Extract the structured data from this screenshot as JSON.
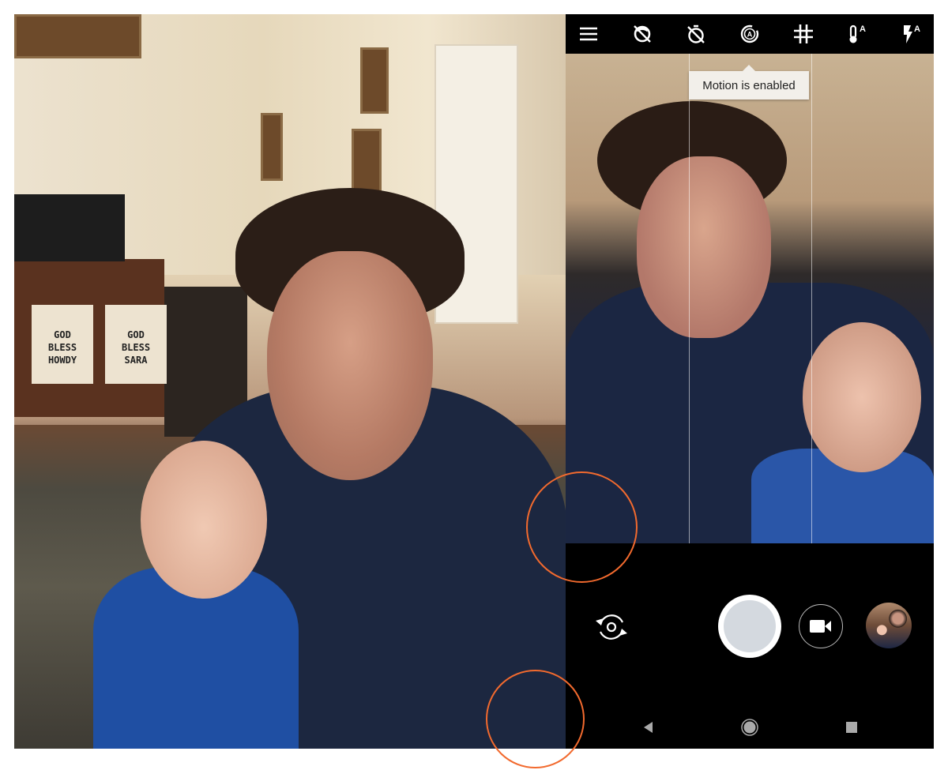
{
  "photo": {
    "banners": [
      "GOD\nBLESS\nHOWDY",
      "GOD\nBLESS\nSARA"
    ]
  },
  "camera": {
    "top_bar": {
      "icons": [
        "menu-icon",
        "hdr-off-icon",
        "timer-off-icon",
        "motion-auto-icon",
        "grid-icon",
        "white-balance-auto-icon",
        "flash-auto-icon"
      ]
    },
    "tooltip": "Motion is enabled",
    "controls": {
      "switch_camera": "switch-camera-icon",
      "shutter": "shutter-button",
      "video": "video-icon",
      "gallery": "gallery-thumbnail"
    },
    "nav_bar": [
      "back-icon",
      "home-icon",
      "recents-icon"
    ]
  },
  "annotation_color": "#f26a2e"
}
